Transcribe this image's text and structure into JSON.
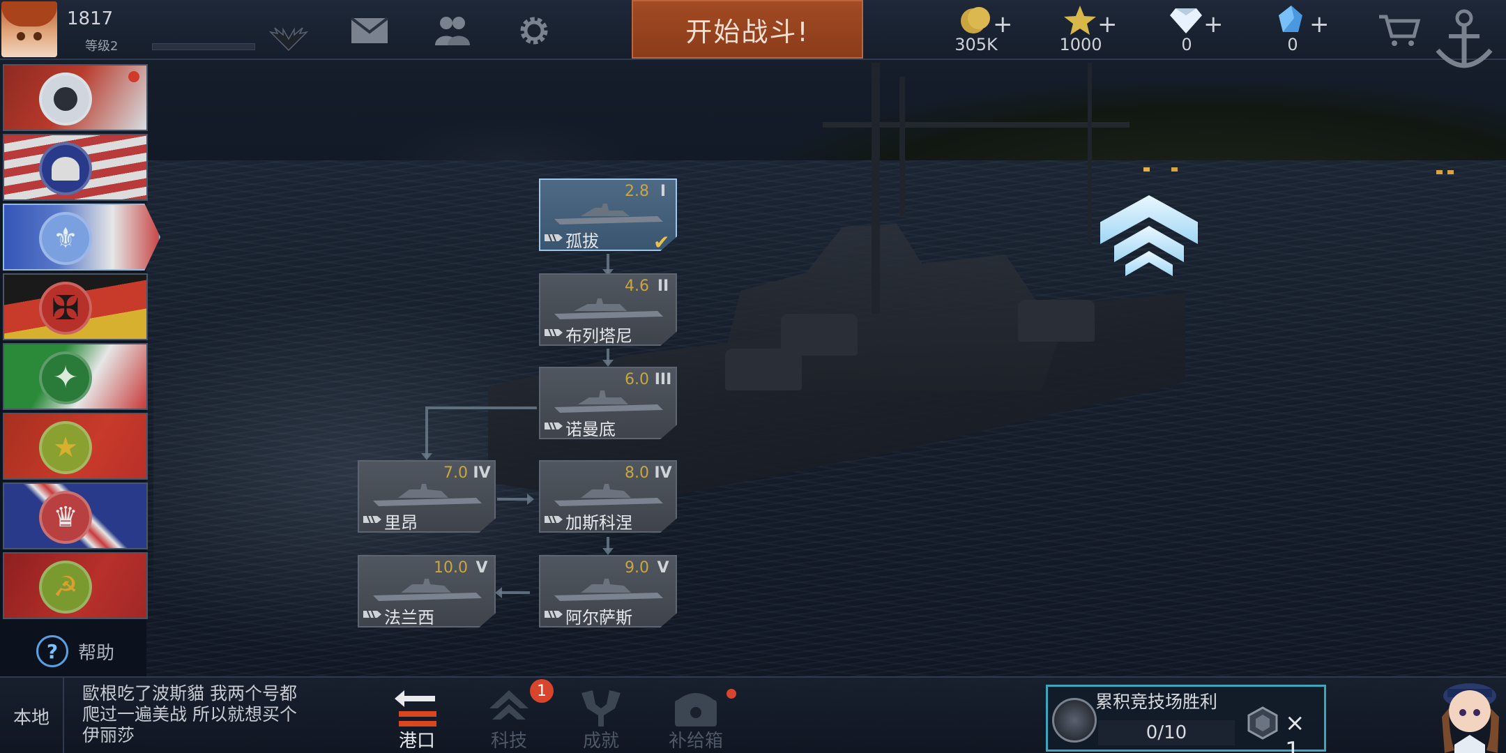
{
  "player": {
    "id": "1817",
    "level_label": "等级2",
    "xp_progress": 0.0
  },
  "top_bar": {
    "start_battle_label": "开始战斗!",
    "resources": [
      {
        "name": "silver-coins",
        "icon": "coin-icon",
        "value": "305K",
        "color": "#c9a640"
      },
      {
        "name": "gold-stars",
        "icon": "star-icon",
        "value": "1000",
        "color": "#d8b848"
      },
      {
        "name": "diamonds",
        "icon": "diamond-icon",
        "value": "0",
        "color": "#e8f2ff"
      },
      {
        "name": "blue-crystals",
        "icon": "crystal-icon",
        "value": "0",
        "color": "#5aa8e8"
      }
    ]
  },
  "nations": [
    {
      "name": "japan",
      "active": false,
      "notification": true,
      "colors": [
        "#b83a2a",
        "#d8dde2"
      ]
    },
    {
      "name": "usa",
      "active": false,
      "notification": false,
      "colors": [
        "#b83a3a",
        "#e6e6e6"
      ]
    },
    {
      "name": "france",
      "active": true,
      "notification": false,
      "colors": [
        "#3456b8",
        "#e6e6e6"
      ]
    },
    {
      "name": "germany",
      "active": false,
      "notification": false,
      "colors": [
        "#1a1a1a",
        "#c83a2a"
      ]
    },
    {
      "name": "italy",
      "active": false,
      "notification": false,
      "colors": [
        "#2a8a3a",
        "#e6e6e6"
      ]
    },
    {
      "name": "china",
      "active": false,
      "notification": false,
      "colors": [
        "#c83a2a",
        "#d8b030"
      ]
    },
    {
      "name": "uk",
      "active": false,
      "notification": false,
      "colors": [
        "#2a3a8a",
        "#c83a3a"
      ]
    },
    {
      "name": "soviet",
      "active": false,
      "notification": false,
      "colors": [
        "#b8302a",
        "#d8a030"
      ]
    }
  ],
  "help_label": "帮助",
  "tech_tree": [
    {
      "name": "孤拔",
      "br": "2.8",
      "tier": "I",
      "selected": true,
      "owned": true
    },
    {
      "name": "布列塔尼",
      "br": "4.6",
      "tier": "II",
      "selected": false,
      "owned": false
    },
    {
      "name": "诺曼底",
      "br": "6.0",
      "tier": "III",
      "selected": false,
      "owned": false
    },
    {
      "name": "里昂",
      "br": "7.0",
      "tier": "IV",
      "selected": false,
      "owned": false
    },
    {
      "name": "加斯科涅",
      "br": "8.0",
      "tier": "IV",
      "selected": false,
      "owned": false
    },
    {
      "name": "法兰西",
      "br": "10.0",
      "tier": "V",
      "selected": false,
      "owned": false
    },
    {
      "name": "阿尔萨斯",
      "br": "9.0",
      "tier": "V",
      "selected": false,
      "owned": false
    }
  ],
  "chat": {
    "tab_label": "本地",
    "message": "歐根吃了波斯貓 我两个号都爬过一遍美战 所以就想买个伊丽莎"
  },
  "bottom_nav": [
    {
      "label": "港口",
      "icon": "port-icon",
      "active": true,
      "badge": "",
      "dot": false
    },
    {
      "label": "科技",
      "icon": "tech-icon",
      "active": false,
      "badge": "1",
      "dot": false
    },
    {
      "label": "成就",
      "icon": "achievement-icon",
      "active": false,
      "badge": "",
      "dot": false
    },
    {
      "label": "补给箱",
      "icon": "supply-box-icon",
      "active": false,
      "badge": "",
      "dot": true
    }
  ],
  "task": {
    "title": "累积竞技场胜利",
    "progress": "0/10",
    "reward": "× 1"
  }
}
